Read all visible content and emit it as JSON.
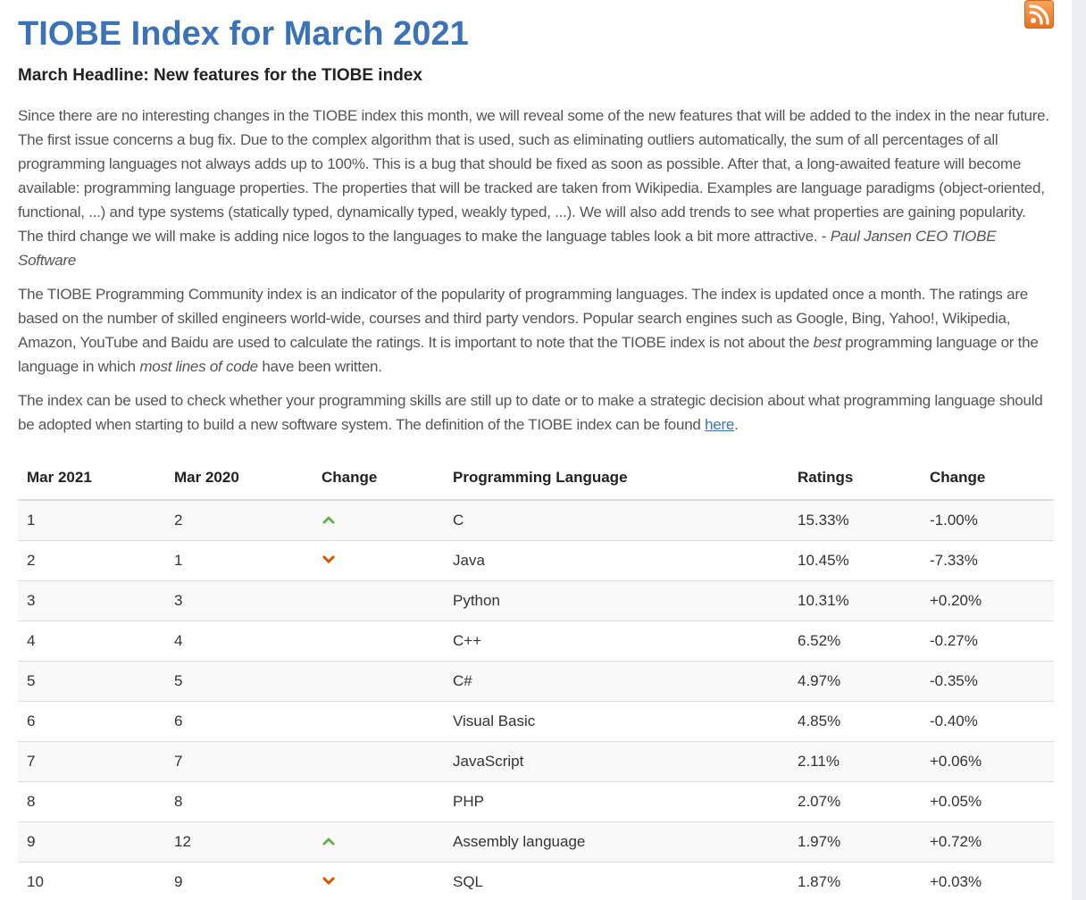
{
  "title": "TIOBE Index for March 2021",
  "headline": "March Headline: New features for the TIOBE index",
  "paragraph1": {
    "text": "Since there are no interesting changes in the TIOBE index this month, we will reveal some of the new features that will be added to the index in the near future. The first issue concerns a bug fix. Due to the complex algorithm that is used, such as eliminating outliers automatically, the sum of all percentages of all programming languages not always adds up to 100%. This is a bug that should be fixed as soon as possible. After that, a long-awaited feature will become available: programming language properties. The properties that will be tracked are taken from Wikipedia. Examples are language paradigms (object-oriented, functional, ...) and type systems (statically typed, dynamically typed, weakly typed, ...). We will also add trends to see what properties are gaining popularity. The third change we will make is adding nice logos to the languages to make the language tables look a bit more attractive. - ",
    "author": "Paul Jansen CEO TIOBE Software"
  },
  "paragraph2": {
    "part1": "The TIOBE Programming Community index is an indicator of the popularity of programming languages. The index is updated once a month. The ratings are based on the number of skilled engineers world-wide, courses and third party vendors. Popular search engines such as Google, Bing, Yahoo!, Wikipedia, Amazon, YouTube and Baidu are used to calculate the ratings. It is important to note that the TIOBE index is not about the ",
    "em1": "best",
    "part2": " programming language or the language in which ",
    "em2": "most lines of code",
    "part3": " have been written."
  },
  "paragraph3": {
    "text": "The index can be used to check whether your programming skills are still up to date or to make a strategic decision about what programming language should be adopted when starting to build a new software system. The definition of the TIOBE index can be found ",
    "link": "here",
    "end": "."
  },
  "table": {
    "headers": [
      "Mar 2021",
      "Mar 2020",
      "Change",
      "Programming Language",
      "Ratings",
      "Change"
    ],
    "rows": [
      {
        "now": "1",
        "prev": "2",
        "trend": "up",
        "language": "C",
        "rating": "15.33%",
        "change": "-1.00%"
      },
      {
        "now": "2",
        "prev": "1",
        "trend": "down",
        "language": "Java",
        "rating": "10.45%",
        "change": "-7.33%"
      },
      {
        "now": "3",
        "prev": "3",
        "trend": "none",
        "language": "Python",
        "rating": "10.31%",
        "change": "+0.20%"
      },
      {
        "now": "4",
        "prev": "4",
        "trend": "none",
        "language": "C++",
        "rating": "6.52%",
        "change": "-0.27%"
      },
      {
        "now": "5",
        "prev": "5",
        "trend": "none",
        "language": "C#",
        "rating": "4.97%",
        "change": "-0.35%"
      },
      {
        "now": "6",
        "prev": "6",
        "trend": "none",
        "language": "Visual Basic",
        "rating": "4.85%",
        "change": "-0.40%"
      },
      {
        "now": "7",
        "prev": "7",
        "trend": "none",
        "language": "JavaScript",
        "rating": "2.11%",
        "change": "+0.06%"
      },
      {
        "now": "8",
        "prev": "8",
        "trend": "none",
        "language": "PHP",
        "rating": "2.07%",
        "change": "+0.05%"
      },
      {
        "now": "9",
        "prev": "12",
        "trend": "up",
        "language": "Assembly language",
        "rating": "1.97%",
        "change": "+0.72%"
      },
      {
        "now": "10",
        "prev": "9",
        "trend": "down",
        "language": "SQL",
        "rating": "1.87%",
        "change": "+0.03%"
      }
    ]
  },
  "icons": {
    "feed": "rss-icon",
    "up": "chevron-up-icon",
    "down": "chevron-down-icon"
  },
  "colors": {
    "title": "#3c73b6",
    "up": "#6ab04c",
    "down": "#d35400",
    "rss": "#e8731d"
  }
}
